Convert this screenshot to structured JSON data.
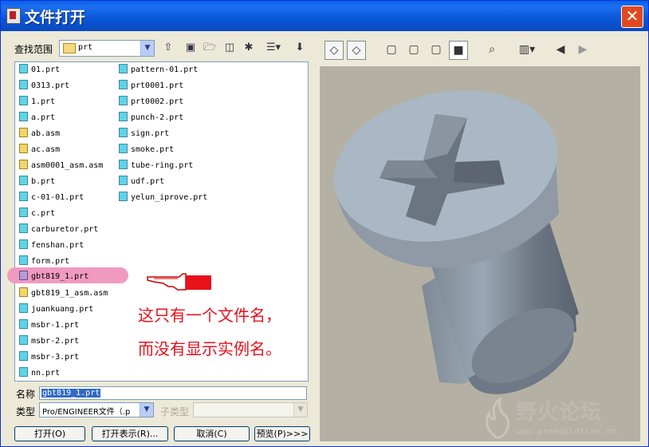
{
  "window": {
    "title": "文件打开",
    "close_glyph": "✕"
  },
  "lookin": {
    "label": "查找范围",
    "value": "prt"
  },
  "toolbar_icons": [
    "up-folder-icon",
    "desktop-icon",
    "open-folder-icon",
    "new-folder-icon",
    "working-dir-icon",
    "view-menu-icon",
    "options-icon"
  ],
  "files_col1": [
    "01.prt",
    "0313.prt",
    "1.prt",
    "a.prt",
    "ab.asm",
    "ac.asm",
    "asm0001_asm.asm",
    "b.prt",
    "c-01-01.prt",
    "c.prt",
    "carburetor.prt",
    "fenshan.prt",
    "form.prt",
    "gbt819_1.prt",
    "gbt819_1_asm.asm",
    "juankuang.prt",
    "msbr-1.prt",
    "msbr-2.prt",
    "msbr-3.prt",
    "nn.prt"
  ],
  "files_col2": [
    "pattern-01.prt",
    "prt0001.prt",
    "prt0002.prt",
    "punch-2.prt",
    "sign.prt",
    "smoke.prt",
    "tube-ring.prt",
    "udf.prt",
    "yelun_iprove.prt"
  ],
  "annotation": {
    "line1": "这只有一个文件名，",
    "line2": "而没有显示实例名。"
  },
  "name": {
    "label": "名称",
    "value": "gbt819_1.prt"
  },
  "type": {
    "label": "类型",
    "value": "Pro/ENGINEER文件（.p",
    "subtype_label": "子类型"
  },
  "buttons": {
    "open": "打开(O)",
    "open_rep": "打开表示(R)...",
    "cancel": "取消(C)",
    "preview": "预览(P)>>>"
  },
  "watermark": {
    "brand": "野火论坛",
    "url": "www.proewildfire.cn"
  },
  "colors": {
    "title_bar": "#0a5ee8",
    "highlight": "#f09ac0",
    "annotation": "#e8111b",
    "viewport": "#b4b1a4"
  }
}
